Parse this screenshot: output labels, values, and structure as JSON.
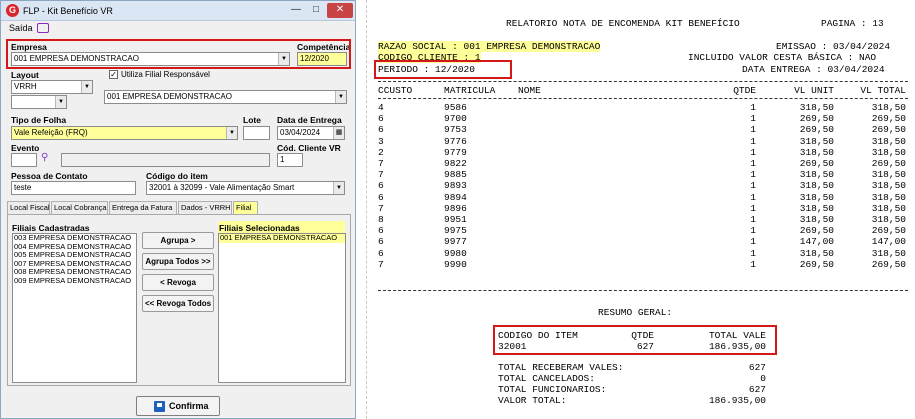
{
  "window": {
    "title": "FLP - Kit Benefício VR",
    "menu_saida": "Saída",
    "controls": {
      "minimize": "—",
      "maximize": "□",
      "close": "✕"
    }
  },
  "form": {
    "empresa_label": "Empresa",
    "empresa_value": "001 EMPRESA DEMONSTRACAO",
    "competencia_label": "Competência",
    "competencia_value": "12/2020",
    "layout_label": "Layout",
    "layout_value": "VRRH",
    "utiliza_filial_label": "Utiliza Filial Responsável",
    "filial_responsavel_value": "001 EMPRESA DEMONSTRACAO",
    "tipo_folha_label": "Tipo de Folha",
    "tipo_folha_value": "Vale Refeição (FRQ)",
    "lote_label": "Lote",
    "data_entrega_label": "Data de Entrega",
    "data_entrega_value": "03/04/2024",
    "evento_label": "Evento",
    "cod_cliente_label": "Cód. Cliente VR",
    "cod_cliente_value": "1",
    "pessoa_contato_label": "Pessoa de Contato",
    "pessoa_contato_value": "teste",
    "codigo_item_label": "Código do item",
    "codigo_item_value": "32001 à 32099 - Vale Alimentação Smart"
  },
  "tabs": [
    "Local Fiscal",
    "Local Cobrança",
    "Entrega da Fatura",
    "Dados - VRRH",
    "Filial"
  ],
  "filial_tab": {
    "cadastradas_label": "Filiais Cadastradas",
    "cadastradas": [
      "003 EMPRESA DEMONSTRACAO",
      "004 EMPRESA DEMONSTRACAO",
      "005 EMPRESA DEMONSTRACAO",
      "007 EMPRESA DEMONSTRACAO",
      "008 EMPRESA DEMONSTRACAO",
      "009 EMPRESA DEMONSTRACAO"
    ],
    "selecionadas_label": "Filiais Selecionadas",
    "selecionadas": [
      "001 EMPRESA DEMONSTRACAO"
    ],
    "agrupa": "Agrupa >",
    "agrupa_todos": "Agrupa Todos >>",
    "revoga": "< Revoga",
    "revoga_todos": "<< Revoga Todos"
  },
  "confirm_label": "Confirma",
  "report": {
    "title": "RELATORIO NOTA DE ENCOMENDA KIT BENEFÍCIO",
    "pagina": "PAGINA : 13",
    "razao_social": "RAZAO SOCIAL : 001 EMPRESA DEMONSTRACAO",
    "codigo_cliente": "CODIGO CLIENTE : 1",
    "periodo": "PERIODO : 12/2020",
    "emissao": "EMISSAO : 03/04/2024",
    "incluido_cesta": "INCLUIDO VALOR CESTA BÁSICA : NAO",
    "data_entrega": "DATA ENTREGA : 03/04/2024",
    "columns": [
      "CCUSTO",
      "MATRICULA",
      "NOME",
      "QTDE",
      "VL UNIT",
      "VL TOTAL"
    ],
    "rows": [
      [
        "4",
        "9586",
        "1",
        "318,50",
        "318,50"
      ],
      [
        "6",
        "9700",
        "1",
        "269,50",
        "269,50"
      ],
      [
        "6",
        "9753",
        "1",
        "269,50",
        "269,50"
      ],
      [
        "3",
        "9776",
        "1",
        "318,50",
        "318,50"
      ],
      [
        "2",
        "9779",
        "1",
        "318,50",
        "318,50"
      ],
      [
        "7",
        "9822",
        "1",
        "269,50",
        "269,50"
      ],
      [
        "7",
        "9885",
        "1",
        "318,50",
        "318,50"
      ],
      [
        "6",
        "9893",
        "1",
        "318,50",
        "318,50"
      ],
      [
        "6",
        "9894",
        "1",
        "318,50",
        "318,50"
      ],
      [
        "7",
        "9896",
        "1",
        "318,50",
        "318,50"
      ],
      [
        "8",
        "9951",
        "1",
        "318,50",
        "318,50"
      ],
      [
        "6",
        "9975",
        "1",
        "269,50",
        "269,50"
      ],
      [
        "6",
        "9977",
        "1",
        "147,00",
        "147,00"
      ],
      [
        "6",
        "9980",
        "1",
        "318,50",
        "318,50"
      ],
      [
        "7",
        "9990",
        "1",
        "269,50",
        "269,50"
      ]
    ],
    "resumo_title": "RESUMO GERAL:",
    "resumo_columns": [
      "CODIGO DO ITEM",
      "QTDE",
      "TOTAL VALE"
    ],
    "resumo_row": [
      "32001",
      "627",
      "186.935,00"
    ],
    "totals": [
      [
        "TOTAL RECEBERAM VALES:",
        "627"
      ],
      [
        "TOTAL CANCELADOS:",
        "0"
      ],
      [
        "TOTAL FUNCIONARIOS:",
        "627"
      ],
      [
        "VALOR TOTAL:",
        "186.935,00"
      ]
    ]
  },
  "colors": {
    "highlight_yellow": "#ffff99",
    "annotation_red": "#d41818",
    "titlebar": "#dbe6f4"
  }
}
